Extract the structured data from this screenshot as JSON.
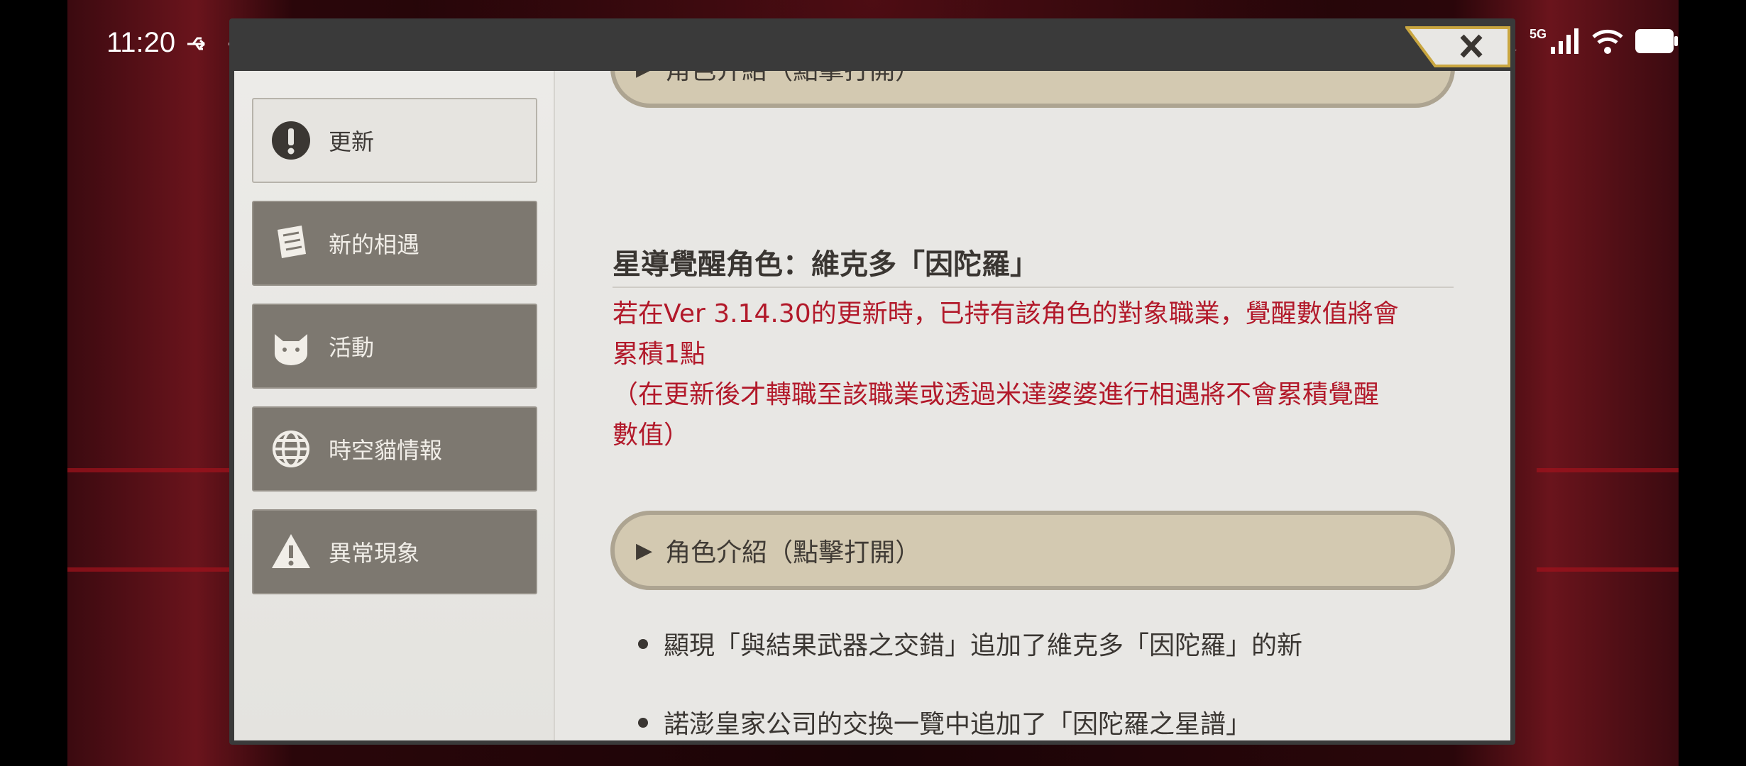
{
  "status_bar": {
    "time": "11:20",
    "extra": "···",
    "icons": [
      "usb-icon",
      "moon-icon",
      "5g-signal-icon",
      "wifi-icon",
      "battery-icon"
    ],
    "network_label": "5G"
  },
  "sidebar": {
    "items": [
      {
        "label": "更新",
        "icon": "exclamation-icon",
        "active": true
      },
      {
        "label": "新的相遇",
        "icon": "scroll-icon",
        "active": false
      },
      {
        "label": "活動",
        "icon": "cat-icon",
        "active": false
      },
      {
        "label": "時空貓情報",
        "icon": "globe-icon",
        "active": false
      },
      {
        "label": "異常現象",
        "icon": "warning-icon",
        "active": false
      }
    ]
  },
  "content": {
    "top_collapse_label": "角色介紹（點擊打開）",
    "heading": "星導覺醒角色：維克多「因陀羅」",
    "notice_line1": "若在Ver 3.14.30的更新時，已持有該角色的對象職業，覺醒數值將會",
    "notice_line2": "累積1點",
    "notice_line3": "（在更新後才轉職至該職業或透過米達婆婆進行相遇將不會累積覺醒",
    "notice_line4": "數值）",
    "collapse_label": "角色介紹（點擊打開）",
    "bullets": [
      "顯現「與結果武器之交錯」追加了維克多「因陀羅」的新",
      "諾澎皇家公司的交換一覽中追加了「因陀羅之星譜」"
    ]
  },
  "colors": {
    "accent_red": "#b2192a",
    "sidebar_button": "#7d7870",
    "collapse_bg": "#d3c9b1",
    "collapse_border": "#ada491"
  }
}
